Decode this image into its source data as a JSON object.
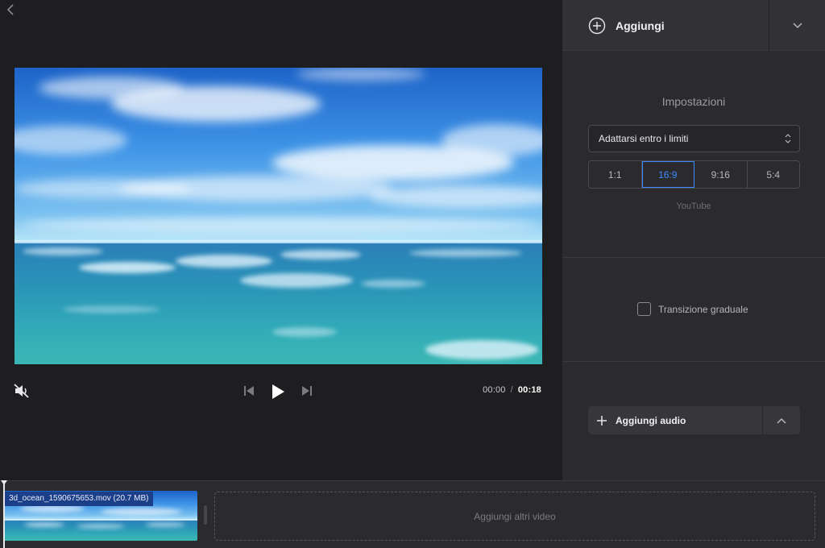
{
  "player": {
    "time_current": "00:00",
    "time_separator": "/",
    "time_total": "00:18",
    "muted": true
  },
  "panel": {
    "add_label": "Aggiungi",
    "settings_title": "Impostazioni",
    "fit_select_value": "Adattarsi entro i limiti",
    "ratios": [
      {
        "label": "1:1",
        "active": false
      },
      {
        "label": "16:9",
        "active": true
      },
      {
        "label": "9:16",
        "active": false
      },
      {
        "label": "5:4",
        "active": false
      }
    ],
    "platform_hint": "YouTube",
    "transition_label": "Transizione graduale",
    "transition_checked": false,
    "add_audio_label": "Aggiungi audio"
  },
  "timeline": {
    "clip_label": "3d_ocean_1590675653.mov (20.7 MB)",
    "add_videos_label": "Aggiungi altri video"
  },
  "colors": {
    "accent": "#3d8bff",
    "background": "#1e1e21",
    "panel": "#2b2b2e",
    "clip_label_bg": "#1c3f8a"
  }
}
